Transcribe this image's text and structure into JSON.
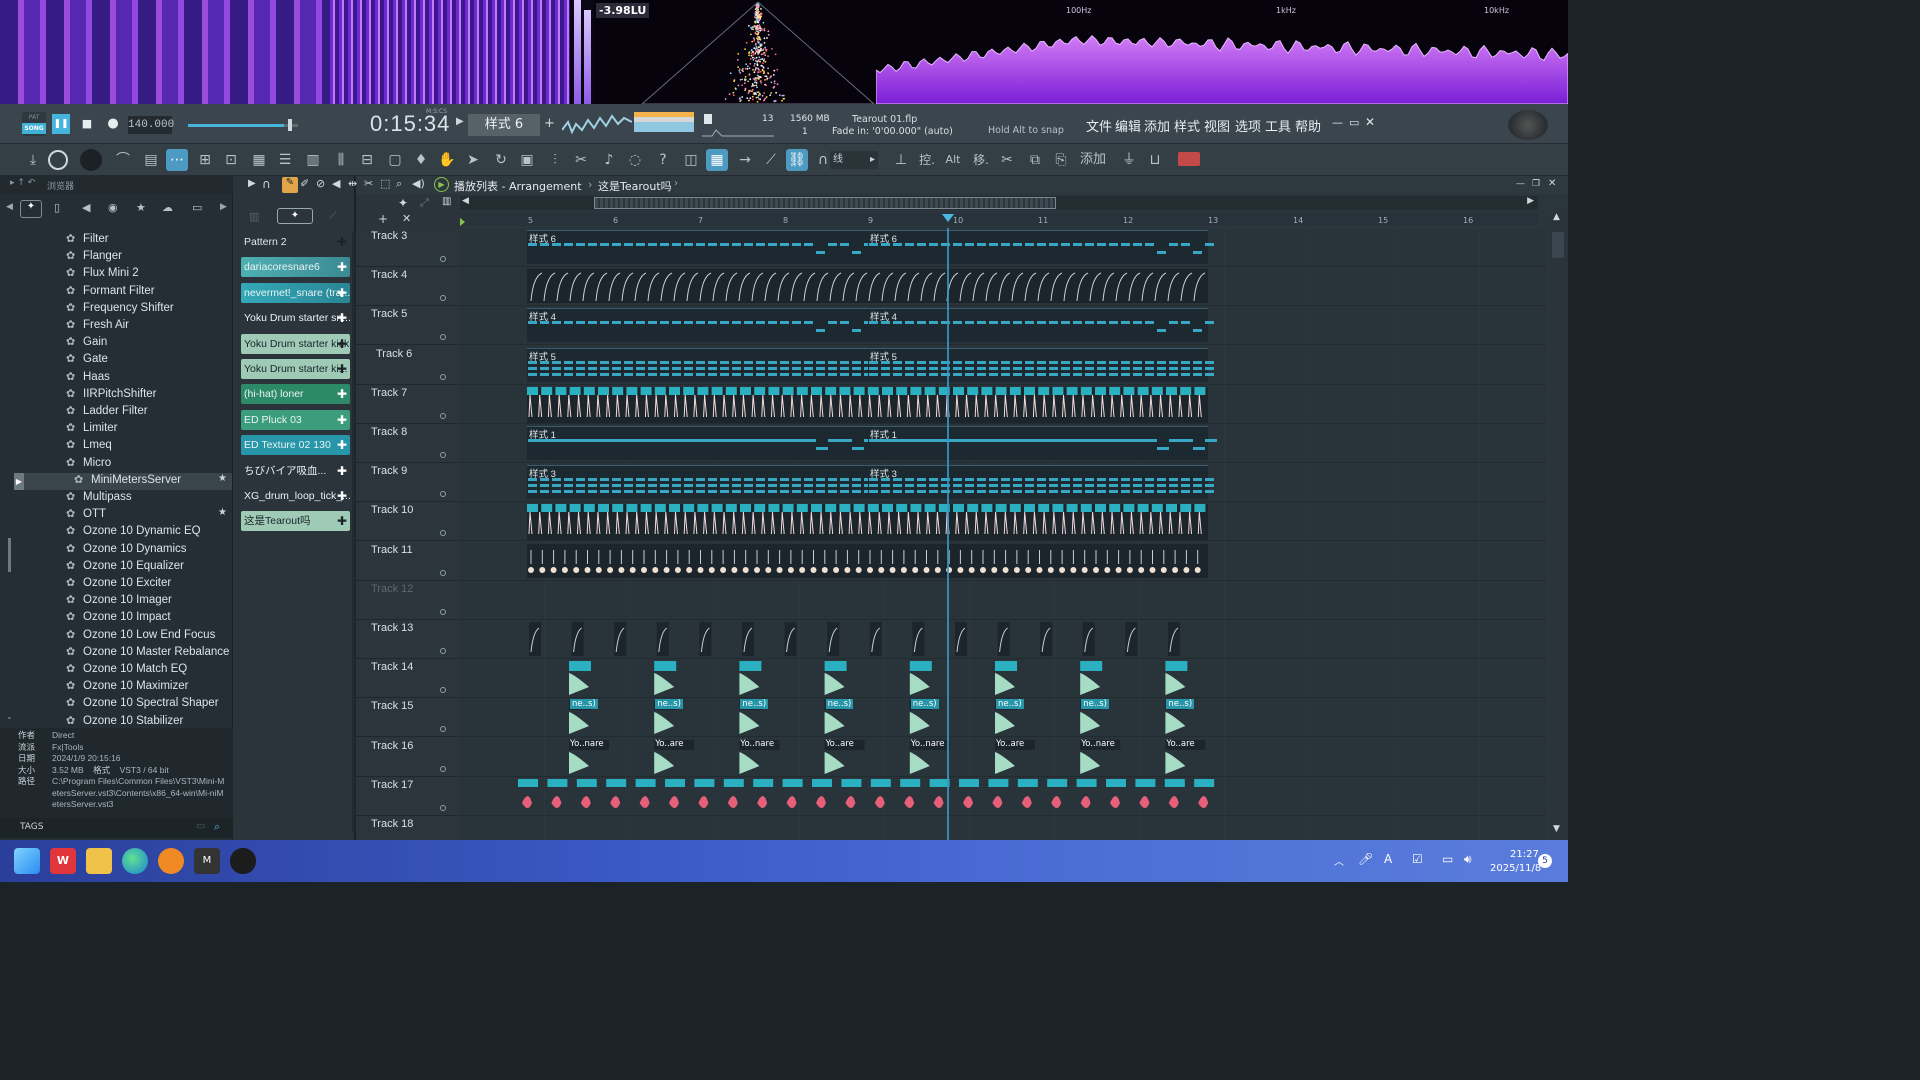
{
  "visualizer": {
    "loudness": "-3.98LU",
    "freq_labels": [
      "100Hz",
      "1kHz",
      "10kHz"
    ]
  },
  "transport": {
    "pat_label": "PAT",
    "song_label": "SONG",
    "tempo": "140.000",
    "time": "0:15:34",
    "time_unit": "M:S:CS",
    "pattern_selector": "样式 6",
    "cpu_value": "13",
    "memory": "1560 MB",
    "voices": "1",
    "project_file": "Tearout 01.flp",
    "hint": "Fade in: '0'00.000\" (auto)",
    "snap_hint": "Hold Alt to snap",
    "menu": [
      "文件",
      "编辑",
      "添加",
      "样式",
      "视图",
      "选项",
      "工具",
      "帮助"
    ]
  },
  "toolbar": {
    "snap_label": "线",
    "alt_label": "Alt",
    "move_label": "移.",
    "add_label": "添加",
    "ctrl_label": "控."
  },
  "browser": {
    "title": "浏览器",
    "items": [
      "Filter",
      "Flanger",
      "Flux Mini 2",
      "Formant Filter",
      "Frequency Shifter",
      "Fresh Air",
      "Gain",
      "Gate",
      "Haas",
      "IIRPitchShifter",
      "Ladder Filter",
      "Limiter",
      "Lmeq",
      "Micro",
      "MiniMetersServer",
      "Multipass",
      "OTT",
      "Ozone 10 Dynamic EQ",
      "Ozone 10 Dynamics",
      "Ozone 10 Equalizer",
      "Ozone 10 Exciter",
      "Ozone 10 Imager",
      "Ozone 10 Impact",
      "Ozone 10 Low End Focus",
      "Ozone 10 Master Rebalance",
      "Ozone 10 Match EQ",
      "Ozone 10 Maximizer",
      "Ozone 10 Spectral Shaper",
      "Ozone 10 Stabilizer"
    ],
    "selected": "MiniMetersServer",
    "info_keys": [
      "作者",
      "流派",
      "日期",
      "大小",
      "路径"
    ],
    "info_author": "Direct",
    "info_genre": "Fx|Tools",
    "info_date": "2024/1/9 20:15:16",
    "info_size": "3.52 MB",
    "info_format_key": "格式",
    "info_format": "VST3 / 64 bit",
    "info_path": "C:\\Program Files\\Common Files\\VST3\\Mini-MetersServer.vst3\\Contents\\x86_64-win\\Mi-niMetersServer.vst3",
    "tags_label": "TAGS"
  },
  "picker": {
    "items": [
      "Pattern 2",
      "dariacoresnare6",
      "nevermet!_snare (tra...",
      "Yoku Drum starter sn...",
      "Yoku Drum starter kick",
      "Yoku Drum starter ki...",
      "(hi-hat) loner",
      "ED Pluck 03",
      "ED Texture 02 130",
      "ちびバイア吸血...",
      "XG_drum_loop_tick_...",
      "这是Tearout吗"
    ]
  },
  "playlist": {
    "title": "播放列表 - Arrangement",
    "breadcrumb": "这是Tearout吗",
    "bars": [
      "5",
      "6",
      "7",
      "8",
      "9",
      "10",
      "11",
      "12",
      "13",
      "14",
      "15",
      "16"
    ],
    "tracks": [
      "Track 3",
      "Track 4",
      "Track 5",
      "Track 6",
      "Track 7",
      "Track 8",
      "Track 9",
      "Track 10",
      "Track 11",
      "Track 12",
      "Track 13",
      "Track 14",
      "Track 15",
      "Track 16",
      "Track 17",
      "Track 18"
    ],
    "clip_labels": {
      "t3": "样式 6",
      "t5": "样式 4",
      "t6": "样式 5",
      "t8": "样式 1",
      "t9": "样式 3",
      "t15": "ne..s)",
      "t16a": "Yo..nare",
      "t16b": "Yo..are"
    }
  },
  "taskbar": {
    "time": "21:27",
    "date": "2025/11/8",
    "notif_count": "5"
  },
  "colors": {
    "accent": "#38a7c4",
    "clip_teal": "#2fb3c9",
    "clip_green": "#8fd6b5",
    "clip_pink": "#e7607a",
    "playhead": "#3fa9d8"
  }
}
